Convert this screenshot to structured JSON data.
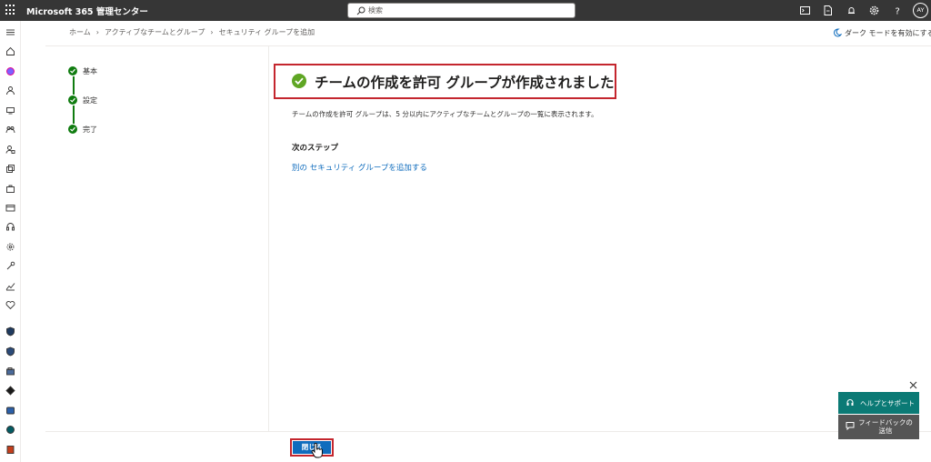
{
  "app": {
    "title": "Microsoft 365 管理センター"
  },
  "search": {
    "placeholder": "検索"
  },
  "user": {
    "initials": "AY"
  },
  "topbar_icons": [
    "terminal-icon",
    "document-icon",
    "bell-icon",
    "gear-icon",
    "help-icon"
  ],
  "rail_icons": [
    "menu-icon",
    "home-icon",
    "copilot-icon",
    "user-icon",
    "devices-icon",
    "teams-icon",
    "roles-icon",
    "resources-icon",
    "marketplace-icon",
    "billing-icon",
    "support-icon",
    "settings-icon",
    "setup-icon",
    "reports-icon",
    "health-icon",
    "security-icon",
    "defender-icon",
    "compliance-icon",
    "azure-icon",
    "exchange-icon",
    "sharepoint-icon",
    "office-icon"
  ],
  "breadcrumb": {
    "home": "ホーム",
    "teams_groups": "アクティブなチームとグループ",
    "current": "セキュリティ グループを追加"
  },
  "dark_mode_label": "ダーク モードを有効にする",
  "steps": [
    {
      "label": "基本"
    },
    {
      "label": "設定"
    },
    {
      "label": "完了"
    }
  ],
  "result": {
    "title": "チームの作成を許可 グループが作成されました",
    "description": "チームの作成を許可 グループは、5 分以内にアクティブなチームとグループの一覧に表示されます。",
    "next_steps_heading": "次のステップ",
    "add_another_link": "別の セキュリティ グループを追加する"
  },
  "footer": {
    "close_label": "閉じる"
  },
  "help_widget": {
    "help_label": "ヘルプとサポート",
    "feedback_label": "フィードバックの送信"
  },
  "colors": {
    "accent": "#0f6cbd",
    "success": "#107c10",
    "highlight": "#c4262e",
    "topbar": "#363636"
  }
}
